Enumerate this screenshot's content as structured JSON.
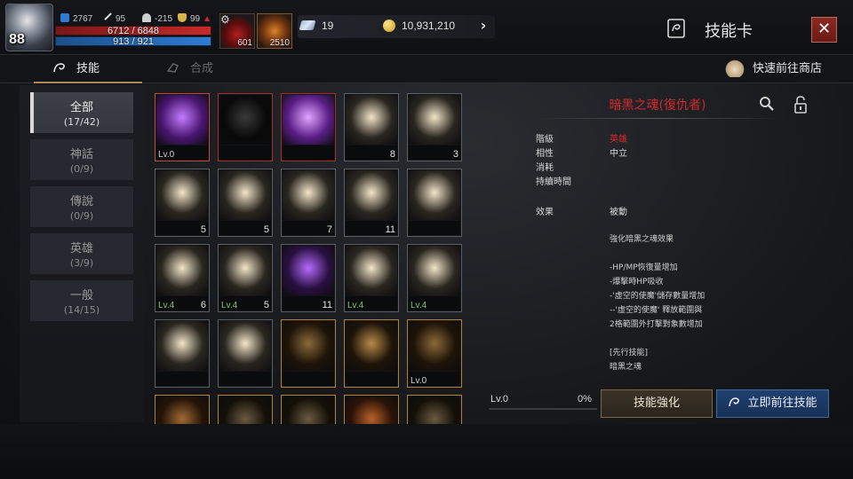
{
  "player": {
    "level": "88",
    "stat_power": "2767",
    "stat_attack": "95",
    "stat_defense": "-215",
    "stat_trophy": "99",
    "hp": "6712 / 6848",
    "mp": "913 / 921"
  },
  "items": [
    {
      "name": "potion-icon",
      "count": "601"
    },
    {
      "name": "scroll-icon",
      "count": "2510"
    }
  ],
  "currency": {
    "gems": "19",
    "gold": "10,931,210"
  },
  "window": {
    "title": "技能卡"
  },
  "tabs": [
    {
      "label": "技能",
      "active": true
    },
    {
      "label": "合成",
      "active": false
    }
  ],
  "shop_link": "快速前往商店",
  "categories": [
    {
      "label": "全部",
      "count": "(17/42)",
      "active": true
    },
    {
      "label": "神話",
      "count": "(0/9)"
    },
    {
      "label": "傳說",
      "count": "(0/9)"
    },
    {
      "label": "英雄",
      "count": "(3/9)"
    },
    {
      "label": "一般",
      "count": "(14/15)"
    }
  ],
  "cards": [
    {
      "icon": "purple-comet-icon",
      "lv": "Lv.0",
      "num": "",
      "style": "sel"
    },
    {
      "icon": "dark-figure-icon",
      "lv": "",
      "num": "",
      "style": "red"
    },
    {
      "icon": "purple-claw-icon",
      "lv": "",
      "num": "",
      "style": "red"
    },
    {
      "icon": "shield-icon",
      "lv": "",
      "num": "8",
      "style": ""
    },
    {
      "icon": "lightning-icon",
      "lv": "",
      "num": "3",
      "style": ""
    },
    {
      "icon": "curved-arrow-icon",
      "lv": "",
      "num": "5",
      "style": ""
    },
    {
      "icon": "burst-icon",
      "lv": "",
      "num": "5",
      "style": ""
    },
    {
      "icon": "crossbow-icon",
      "lv": "",
      "num": "7",
      "style": ""
    },
    {
      "icon": "fireballs-icon",
      "lv": "",
      "num": "11",
      "style": ""
    },
    {
      "icon": "star-shield-icon",
      "lv": "",
      "num": "",
      "style": ""
    },
    {
      "icon": "golden-crest-icon",
      "lv": "Lv.4",
      "num": "6",
      "style": ""
    },
    {
      "icon": "radiant-shockwave-icon",
      "lv": "Lv.4",
      "num": "5",
      "style": ""
    },
    {
      "icon": "purple-spear-icon",
      "lv": "",
      "num": "11",
      "style": ""
    },
    {
      "icon": "arrow-burst-icon",
      "lv": "Lv.4",
      "num": "",
      "style": ""
    },
    {
      "icon": "arrow-shield-icon",
      "lv": "Lv.4",
      "num": "",
      "style": ""
    },
    {
      "icon": "beast-face-icon",
      "lv": "",
      "num": "",
      "style": ""
    },
    {
      "icon": "slash-figure-icon",
      "lv": "",
      "num": "",
      "style": ""
    },
    {
      "icon": "emblem-icon",
      "lv": "",
      "num": "",
      "style": "gold"
    },
    {
      "icon": "skull-flame-icon",
      "lv": "",
      "num": "",
      "style": "gold"
    },
    {
      "icon": "cross-sword-icon",
      "lv": "Lv.0",
      "num": "",
      "style": "gold"
    },
    {
      "icon": "bronze-wave-icon",
      "lv": "",
      "num": "",
      "style": "gold"
    },
    {
      "icon": "horns-icon",
      "lv": "",
      "num": "",
      "style": "gold"
    },
    {
      "icon": "horns-icon",
      "lv": "",
      "num": "",
      "style": "gold"
    },
    {
      "icon": "fire-icon",
      "lv": "",
      "num": "",
      "style": "gold"
    },
    {
      "icon": "horns-icon",
      "lv": "",
      "num": "",
      "style": "gold"
    }
  ],
  "detail": {
    "name": "暗黑之魂(復仇者)",
    "rows": [
      {
        "label": "階級",
        "value": "英雄",
        "red": true
      },
      {
        "label": "相性",
        "value": "中立"
      },
      {
        "label": "消耗",
        "value": ""
      },
      {
        "label": "持續時間",
        "value": ""
      }
    ],
    "effect_label": "效果",
    "effect_value": "被動",
    "desc": [
      "強化暗黑之魂效果",
      "",
      "-HP/MP恢復量增加",
      "-爆擊時HP吸收",
      "-'虛空的使魔'儲存數量增加",
      "--'虛空的使魔' 釋放範圍與",
      "2格範圍外打擊對象數增加",
      "",
      "[先行技能]",
      "暗黑之魂"
    ],
    "level": "Lv.0",
    "percent": "0%",
    "progress": 0,
    "btn_upgrade": "技能強化",
    "btn_goto": "立即前往技能"
  },
  "colors": {
    "accent_red": "#d12a2a",
    "accent_gold": "#b0822e",
    "accent_blue": "#2f6cb8"
  }
}
